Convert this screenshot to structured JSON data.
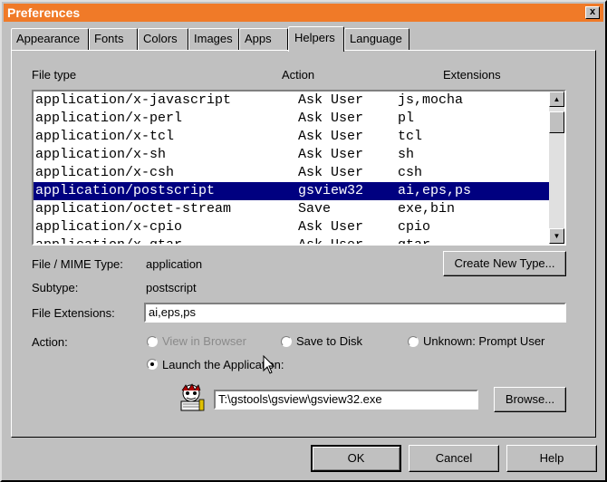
{
  "window": {
    "title": "Preferences",
    "close_glyph": "x",
    "colors": {
      "titlebar": "#f07a28",
      "face": "#c0c0c0",
      "selection": "#000080"
    }
  },
  "tabs": [
    {
      "label": "Appearance",
      "active": false
    },
    {
      "label": "Fonts",
      "active": false
    },
    {
      "label": "Colors",
      "active": false
    },
    {
      "label": "Images",
      "active": false
    },
    {
      "label": "Apps",
      "active": false
    },
    {
      "label": "Helpers",
      "active": true
    },
    {
      "label": "Language",
      "active": false
    }
  ],
  "list": {
    "headers": {
      "file_type": "File type",
      "action": "Action",
      "extensions": "Extensions"
    },
    "rows": [
      {
        "type": "application/x-javascript",
        "action": "Ask User",
        "ext": "js,mocha"
      },
      {
        "type": "application/x-perl",
        "action": "Ask User",
        "ext": "pl"
      },
      {
        "type": "application/x-tcl",
        "action": "Ask User",
        "ext": "tcl"
      },
      {
        "type": "application/x-sh",
        "action": "Ask User",
        "ext": "sh"
      },
      {
        "type": "application/x-csh",
        "action": "Ask User",
        "ext": "csh"
      },
      {
        "type": "application/postscript",
        "action": "gsview32",
        "ext": "ai,eps,ps",
        "selected": true
      },
      {
        "type": "application/octet-stream",
        "action": "Save",
        "ext": "exe,bin"
      },
      {
        "type": "application/x-cpio",
        "action": "Ask User",
        "ext": "cpio"
      },
      {
        "type": "application/x-gtar",
        "action": "Ask User",
        "ext": "gtar"
      }
    ],
    "scroll_up_glyph": "▲",
    "scroll_down_glyph": "▼"
  },
  "details": {
    "mime_label": "File / MIME Type:",
    "mime_value": "application",
    "subtype_label": "Subtype:",
    "subtype_value": "postscript",
    "ext_label": "File Extensions:",
    "ext_value": "ai,eps,ps",
    "create_button": "Create New Type...",
    "action_label": "Action:",
    "options": {
      "view": "View in Browser",
      "save": "Save to Disk",
      "unknown": "Unknown:  Prompt User",
      "launch": "Launch the Application:"
    },
    "app_path": "T:\\gstools\\gsview\\gsview32.exe",
    "browse_button": "Browse..."
  },
  "footer": {
    "ok": "OK",
    "cancel": "Cancel",
    "help": "Help"
  }
}
